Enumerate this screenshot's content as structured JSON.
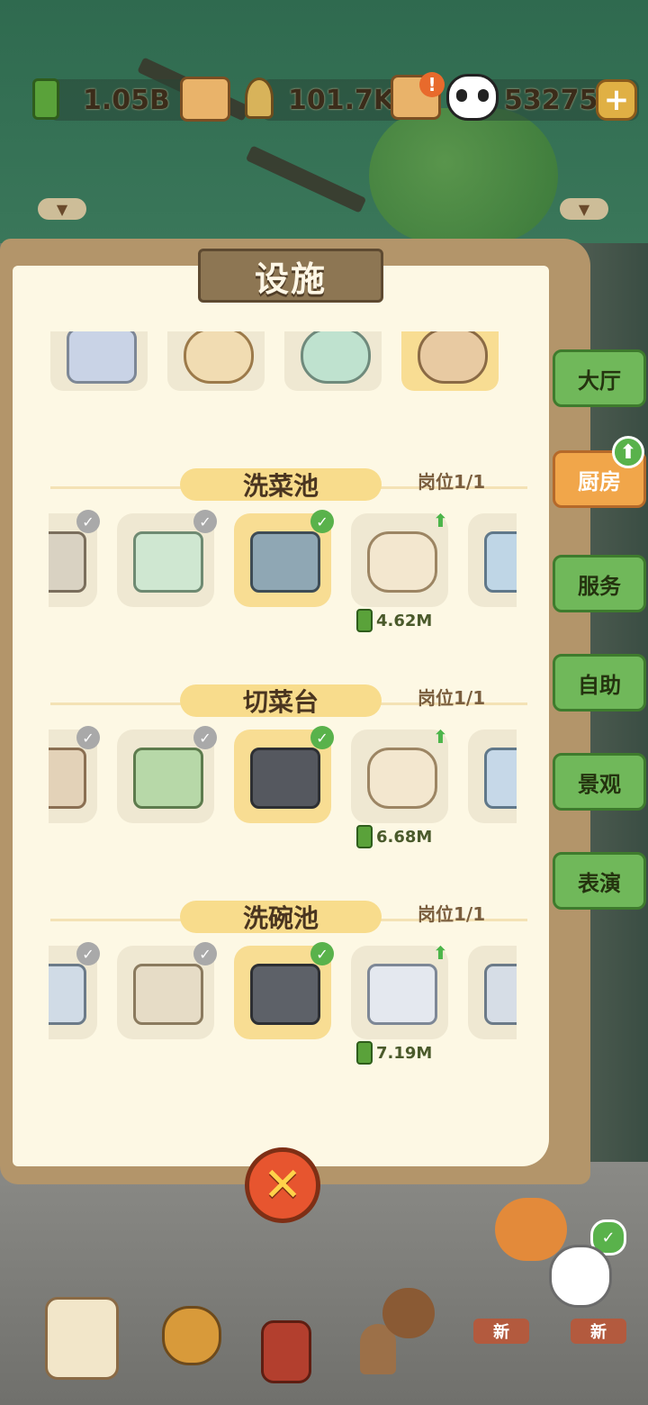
{
  "resources": {
    "bamboo_value": "1.05B",
    "shoot_value": "101.7K",
    "panda_value": "53275",
    "add_symbol": "+"
  },
  "panel": {
    "title": "设施",
    "sections": [
      {
        "name": "洗菜池",
        "slots": "岗位1/1",
        "price": "4.62M"
      },
      {
        "name": "切菜台",
        "slots": "岗位1/1",
        "price": "6.68M"
      },
      {
        "name": "洗碗池",
        "slots": "岗位1/1",
        "price": "7.19M"
      }
    ]
  },
  "side_tabs": [
    "大厅",
    "厨房",
    "服务",
    "自助",
    "景观",
    "表演"
  ],
  "bottom": {
    "new_badge_1": "新",
    "new_badge_2": "新"
  },
  "icons": {
    "close": "✕",
    "check": "✓",
    "up_arrow": "⬆"
  },
  "colors": {
    "accent_green": "#59b24b",
    "active_tab": "#f1a64a",
    "panel_paper": "#fdf8e4"
  }
}
